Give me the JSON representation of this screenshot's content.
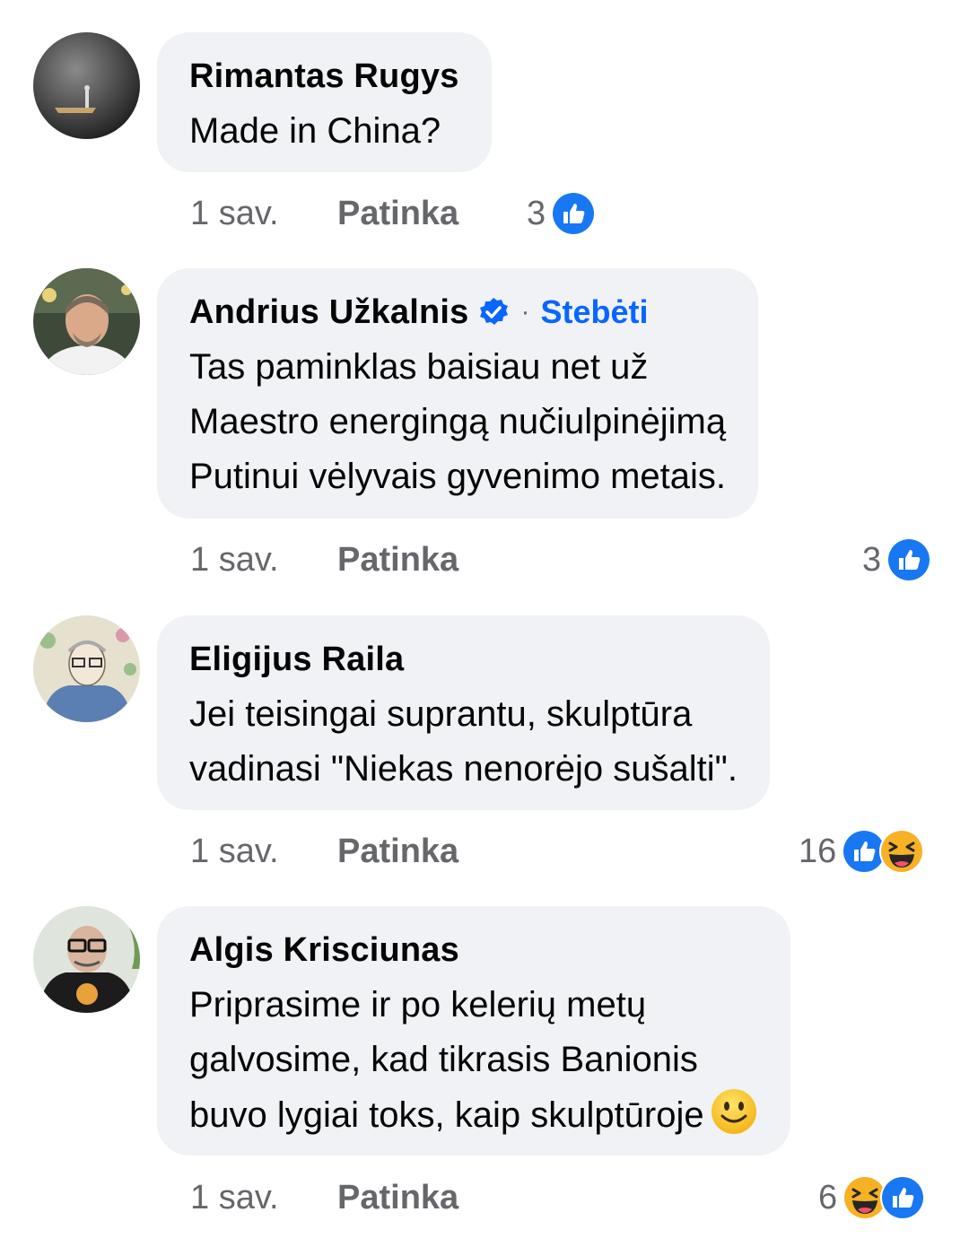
{
  "comments": [
    {
      "author": "Rimantas Rugys",
      "verified": false,
      "lines": [
        "Made in China?"
      ],
      "time": "1 sav.",
      "like_label": "Patinka",
      "reaction_count": "3",
      "reactions": [
        "like-icon"
      ]
    },
    {
      "author": "Andrius Užkalnis",
      "verified": true,
      "follow_label": "Stebėti",
      "separator": "·",
      "lines": [
        "Tas paminklas baisiau net už",
        "Maestro energingą nučiulpinėjimą",
        "Putinui vėlyvais gyvenimo metais."
      ],
      "time": "1 sav.",
      "like_label": "Patinka",
      "reaction_count": "3",
      "reactions": [
        "like-icon"
      ]
    },
    {
      "author": "Eligijus Raila",
      "verified": false,
      "lines": [
        "Jei teisingai suprantu, skulptūra",
        "vadinasi \"Niekas nenorėjo sušalti\"."
      ],
      "time": "1 sav.",
      "like_label": "Patinka",
      "reaction_count": "16",
      "reactions": [
        "like-icon",
        "haha-icon"
      ]
    },
    {
      "author": "Algis Krisciunas",
      "verified": false,
      "lines": [
        "Priprasime ir po kelerių metų",
        "galvosime, kad tikrasis Banionis",
        "buvo lygiai toks, kaip skulptūroje"
      ],
      "trailing_emoji": "smile-emoji",
      "time": "1 sav.",
      "like_label": "Patinka",
      "reaction_count": "6",
      "reactions": [
        "haha-icon",
        "like-icon"
      ]
    }
  ],
  "colors": {
    "bubble": "#f0f2f5",
    "meta_text": "#65676b",
    "link_blue": "#0866ff",
    "like_blue": "#1877f2",
    "haha_yellow": "#f7b125"
  }
}
